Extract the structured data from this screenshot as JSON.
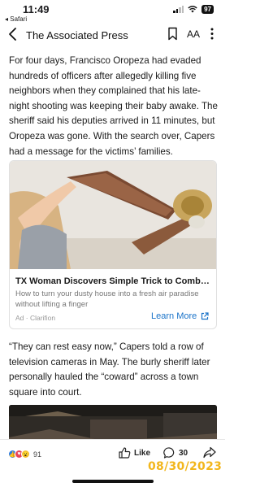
{
  "status": {
    "time": "11:49",
    "back_app": "◂ Safari",
    "battery": "97"
  },
  "nav": {
    "title": "The Associated Press",
    "text_size_label": "AA",
    "icons": [
      "back-chevron-icon",
      "bookmark-icon",
      "more-vertical-icon"
    ]
  },
  "article": {
    "paragraph_1": "For four days, Francisco Oropeza had evaded hundreds of officers after allegedly killing five neighbors when they complained that his late-night shooting was keeping their baby awake. The sheriff said his deputies arrived in 11 minutes, but Oropeza was gone. With the search over, Capers had a message for the victims’ families.",
    "paragraph_2": "“They can rest easy now,” Capers told a row of television cameras in May. The burly sheriff later personally hauled the “coward” across a town square into court."
  },
  "ad": {
    "headline": "TX Woman Discovers Simple Trick to Combat Dust",
    "subtext": "How to turn your dusty house into a fresh air paradise without lifting a finger",
    "label": "Ad · Clarifion",
    "cta": "Learn More",
    "cta_color": "#1a73c9"
  },
  "bottom_bar": {
    "reaction_count": "91",
    "like_label": "Like",
    "comment_count": "30",
    "icons": [
      "like-thumb-icon",
      "comment-bubble-icon",
      "share-arrow-icon"
    ]
  },
  "date_stamp": {
    "text": "08/30/2023",
    "color": "#f2b61c"
  }
}
